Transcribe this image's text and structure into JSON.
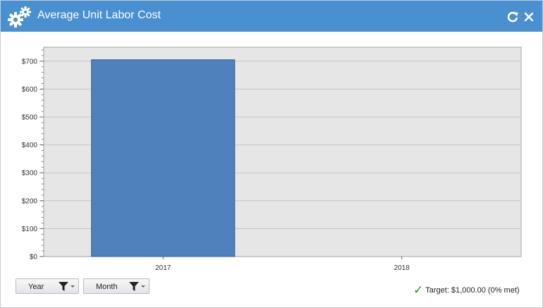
{
  "window": {
    "title": "Average Unit Labor Cost",
    "icons": {
      "app": "gears-icon",
      "refresh": "refresh-icon",
      "close": "close-icon"
    },
    "header_color": "#4a8fd0"
  },
  "chart_data": {
    "type": "bar",
    "categories": [
      "2017",
      "2018"
    ],
    "values": [
      705,
      0
    ],
    "ylim": [
      0,
      750
    ],
    "yticks": [
      0,
      100,
      200,
      300,
      400,
      500,
      600,
      700
    ],
    "ytick_labels": [
      "$0",
      "$100",
      "$200",
      "$300",
      "$400",
      "$500",
      "$600",
      "$700"
    ],
    "title": "",
    "xlabel": "",
    "ylabel": "",
    "grid": true,
    "bar_color": "#4f81bd",
    "plot_background": "#e6e6e6"
  },
  "filters": {
    "year_label": "Year",
    "month_label": "Month",
    "filter_icon": "funnel-icon"
  },
  "status": {
    "target_text": "Target: $1,000.00 (0% met)",
    "check_icon": "checkmark-icon",
    "check_color": "#2f8f2f"
  }
}
